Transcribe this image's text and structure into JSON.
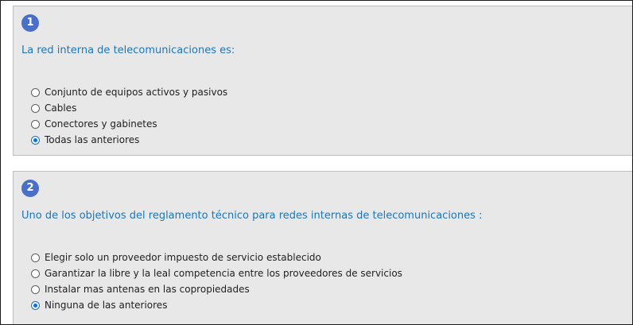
{
  "questions": [
    {
      "number": "1",
      "text": "La red interna de telecomunicaciones es:",
      "options": [
        {
          "label": "Conjunto de equipos activos y pasivos",
          "selected": false
        },
        {
          "label": "Cables",
          "selected": false
        },
        {
          "label": "Conectores y gabinetes",
          "selected": false
        },
        {
          "label": "Todas las anteriores",
          "selected": true
        }
      ]
    },
    {
      "number": "2",
      "text": "Uno de los objetivos del reglamento técnico para redes internas de telecomunicaciones :",
      "options": [
        {
          "label": "Elegir solo un proveedor impuesto de servicio establecido",
          "selected": false
        },
        {
          "label": "Garantizar la libre y la leal competencia entre los proveedores de servicios",
          "selected": false
        },
        {
          "label": "Instalar mas antenas en las copropiedades",
          "selected": false
        },
        {
          "label": "Ninguna de las anteriores",
          "selected": true
        }
      ]
    }
  ],
  "colors": {
    "number_badge": "#4a6fc9",
    "question_text": "#1d76b8",
    "panel_bg": "#e8e8e8",
    "radio_checked": "#0c6fe0"
  }
}
